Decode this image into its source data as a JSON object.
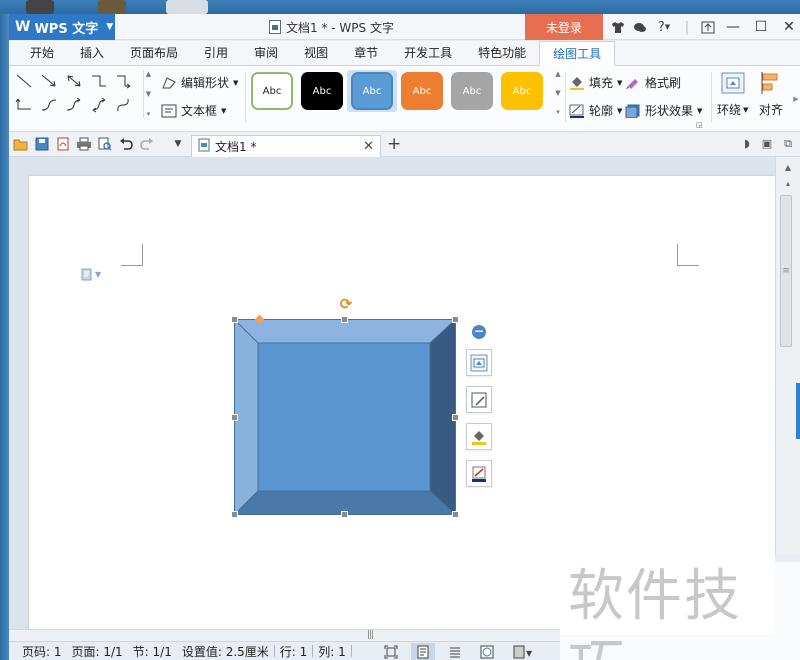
{
  "app": {
    "logo_text": "WPS 文字",
    "doc_title": "文档1 * - WPS 文字",
    "login_label": "未登录"
  },
  "menu": {
    "tabs": [
      "开始",
      "插入",
      "页面布局",
      "引用",
      "审阅",
      "视图",
      "章节",
      "开发工具",
      "特色功能",
      "绘图工具"
    ],
    "active_tab": "绘图工具"
  },
  "ribbon": {
    "edit_shape": "编辑形状",
    "text_box": "文本框",
    "style_label": "Abc",
    "style_colors": [
      "#ffffff",
      "#000000",
      "#5b9bd5",
      "#ed7d31",
      "#a5a5a5",
      "#ffc000"
    ],
    "fill": "填充",
    "format_painter": "格式刷",
    "outline": "轮廓",
    "shape_effects": "形状效果",
    "wrap": "环绕",
    "align": "对齐"
  },
  "doc_tab": {
    "name": "文档1 *"
  },
  "shape": {
    "fill": "#5b95d0",
    "type": "bevel"
  },
  "status": {
    "page": "页码: 1",
    "pages": "页面: 1/1",
    "section": "节: 1/1",
    "setting": "设置值: 2.5厘米",
    "row": "行: 1",
    "col": "列: 1"
  },
  "watermark": "软件技巧"
}
